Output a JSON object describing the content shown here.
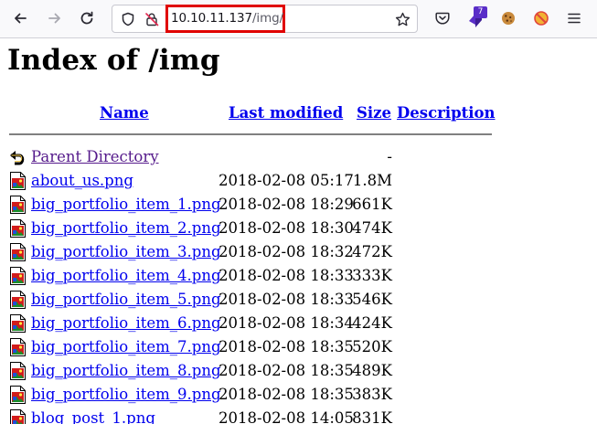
{
  "browser": {
    "url_host": "10.10.11.137",
    "url_path": "/img/",
    "extension_badge_count": "7"
  },
  "page": {
    "title": "Index of /img",
    "columns": {
      "name": "Name",
      "last_modified": "Last modified",
      "size": "Size",
      "description": "Description"
    },
    "parent": {
      "name": "Parent Directory",
      "size": "-"
    },
    "files": [
      {
        "name": "about_us.png",
        "date": "2018-02-08 05:17",
        "size": "1.8M"
      },
      {
        "name": "big_portfolio_item_1.png",
        "date": "2018-02-08 18:29",
        "size": "661K"
      },
      {
        "name": "big_portfolio_item_2.png",
        "date": "2018-02-08 18:30",
        "size": "474K"
      },
      {
        "name": "big_portfolio_item_3.png",
        "date": "2018-02-08 18:32",
        "size": "472K"
      },
      {
        "name": "big_portfolio_item_4.png",
        "date": "2018-02-08 18:33",
        "size": "333K"
      },
      {
        "name": "big_portfolio_item_5.png",
        "date": "2018-02-08 18:33",
        "size": "546K"
      },
      {
        "name": "big_portfolio_item_6.png",
        "date": "2018-02-08 18:34",
        "size": "424K"
      },
      {
        "name": "big_portfolio_item_7.png",
        "date": "2018-02-08 18:35",
        "size": "520K"
      },
      {
        "name": "big_portfolio_item_8.png",
        "date": "2018-02-08 18:35",
        "size": "489K"
      },
      {
        "name": "big_portfolio_item_9.png",
        "date": "2018-02-08 18:35",
        "size": "383K"
      },
      {
        "name": "blog_post_1.png",
        "date": "2018-02-08 14:05",
        "size": "831K"
      }
    ]
  },
  "icons": {
    "back": "arrow-left-icon",
    "forward": "arrow-right-icon",
    "reload": "reload-icon",
    "shield": "tracking-shield-icon",
    "insecure": "insecure-lock-icon",
    "bookmark": "star-icon",
    "pocket": "pocket-icon",
    "extension": "extension-icon",
    "cookie": "cookie-icon",
    "blocker": "blocker-icon",
    "menu": "hamburger-menu-icon",
    "parent": "back-folder-icon",
    "image_file": "image-file-icon"
  },
  "colors": {
    "link": "#0000ee",
    "visited_link": "#551a8b",
    "highlight_box": "#e00000",
    "badge": "#5a2ec8"
  }
}
